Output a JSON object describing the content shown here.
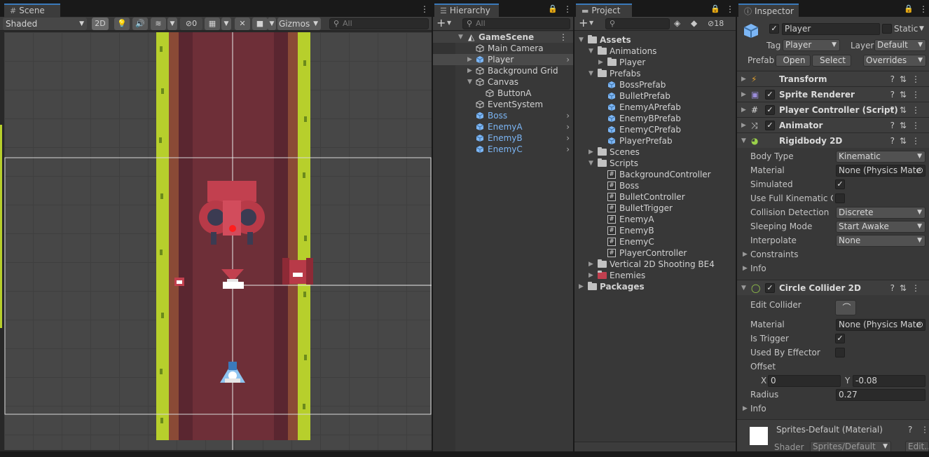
{
  "scene": {
    "tab": "Scene",
    "shading": "Shaded",
    "mode_2d": "2D",
    "hidden_count": "0",
    "gizmos": "Gizmos",
    "search_placeholder": "All"
  },
  "hierarchy": {
    "tab": "Hierarchy",
    "search_placeholder": "All",
    "scene_name": "GameScene",
    "items": [
      {
        "label": "Main Camera",
        "prefab": false
      },
      {
        "label": "Player",
        "prefab": true
      },
      {
        "label": "Background Grid",
        "prefab": false
      },
      {
        "label": "Canvas",
        "prefab": false
      },
      {
        "label": "ButtonA",
        "prefab": false
      },
      {
        "label": "EventSystem",
        "prefab": false
      },
      {
        "label": "Boss",
        "prefab": true
      },
      {
        "label": "EnemyA",
        "prefab": true
      },
      {
        "label": "EnemyB",
        "prefab": true
      },
      {
        "label": "EnemyC",
        "prefab": true
      }
    ]
  },
  "project": {
    "tab": "Project",
    "hidden_count": "18",
    "tree": [
      {
        "label": "Assets",
        "kind": "folder"
      },
      {
        "label": "Animations",
        "kind": "folder"
      },
      {
        "label": "Player",
        "kind": "folder"
      },
      {
        "label": "Prefabs",
        "kind": "folder"
      },
      {
        "label": "BossPrefab",
        "kind": "prefab"
      },
      {
        "label": "BulletPrefab",
        "kind": "prefab"
      },
      {
        "label": "EnemyAPrefab",
        "kind": "prefab"
      },
      {
        "label": "EnemyBPrefab",
        "kind": "prefab"
      },
      {
        "label": "EnemyCPrefab",
        "kind": "prefab"
      },
      {
        "label": "PlayerPrefab",
        "kind": "prefab"
      },
      {
        "label": "Scenes",
        "kind": "folder"
      },
      {
        "label": "Scripts",
        "kind": "folder"
      },
      {
        "label": "BackgroundController",
        "kind": "script"
      },
      {
        "label": "Boss",
        "kind": "script"
      },
      {
        "label": "BulletController",
        "kind": "script"
      },
      {
        "label": "BulletTrigger",
        "kind": "script"
      },
      {
        "label": "EnemyA",
        "kind": "script"
      },
      {
        "label": "EnemyB",
        "kind": "script"
      },
      {
        "label": "EnemyC",
        "kind": "script"
      },
      {
        "label": "PlayerController",
        "kind": "script"
      },
      {
        "label": "Vertical 2D Shooting BE4",
        "kind": "folder"
      },
      {
        "label": "Enemies",
        "kind": "sprite"
      },
      {
        "label": "Packages",
        "kind": "folder"
      }
    ]
  },
  "inspector": {
    "tab": "Inspector",
    "object_name": "Player",
    "static_label": "Static",
    "tag_label": "Tag",
    "tag_value": "Player",
    "layer_label": "Layer",
    "layer_value": "Default",
    "prefab_label": "Prefab",
    "open_btn": "Open",
    "select_btn": "Select",
    "overrides_btn": "Overrides",
    "components": {
      "transform": "Transform",
      "sprite_renderer": "Sprite Renderer",
      "player_controller": "Player Controller (Script)",
      "animator": "Animator",
      "rigidbody": "Rigidbody 2D",
      "circle_collider": "Circle Collider 2D"
    },
    "rigidbody": {
      "body_type_label": "Body Type",
      "body_type": "Kinematic",
      "material_label": "Material",
      "material": "None (Physics Mate",
      "simulated_label": "Simulated",
      "full_kinematic_label": "Use Full Kinematic Co",
      "collision_label": "Collision Detection",
      "collision": "Discrete",
      "sleeping_label": "Sleeping Mode",
      "sleeping": "Start Awake",
      "interpolate_label": "Interpolate",
      "interpolate": "None",
      "constraints_label": "Constraints",
      "info_label": "Info"
    },
    "collider": {
      "edit_label": "Edit Collider",
      "material_label": "Material",
      "material": "None (Physics Mate",
      "trigger_label": "Is Trigger",
      "effector_label": "Used By Effector",
      "offset_label": "Offset",
      "x_label": "X",
      "x": "0",
      "y_label": "Y",
      "y": "-0.08",
      "radius_label": "Radius",
      "radius": "0.27",
      "info_label": "Info"
    },
    "material": {
      "name": "Sprites-Default (Material)",
      "shader_label": "Shader",
      "shader": "Sprites/Default",
      "edit_btn": "Edit..."
    }
  },
  "colors": {
    "accent": "#3a79bb",
    "prefab_blue": "#7cb6f5",
    "grass": "#b7cf2c",
    "road": "#6e2f38",
    "dirt": "#8a4a36"
  }
}
